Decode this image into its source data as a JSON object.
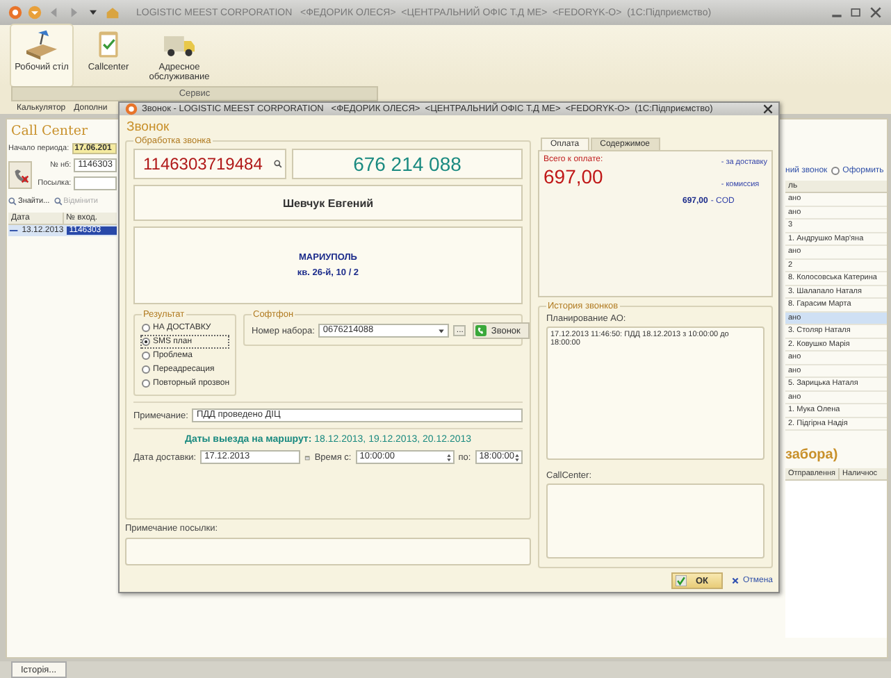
{
  "window": {
    "title": "LOGISTIC MEEST CORPORATION   <ФЕДОРИК ОЛЕСЯ>  <ЦЕНТРАЛЬНИЙ ОФІС Т.Д МЕ>  <FEDORYK-O>  (1С:Підприємство)"
  },
  "ribbon": [
    {
      "label": "Робочий стіл",
      "kind": "desk",
      "selected": true
    },
    {
      "label": "Callcenter",
      "kind": "clipboard",
      "selected": false
    },
    {
      "label": "Адресное обслуживание",
      "kind": "truck",
      "selected": false
    }
  ],
  "service_bar": {
    "title": "Сервис",
    "items": [
      "Калькулятор",
      "Дополни"
    ]
  },
  "call_center": {
    "title": "Call Center",
    "period_label": "Начало периода:",
    "period_value": "17.06.201",
    "nb_label": "№ нб:",
    "nb_value": "1146303",
    "parcel_label": "Посылка:",
    "actions": [
      {
        "label": "Знайти...",
        "disabled": false
      },
      {
        "label": "Відмінити",
        "disabled": true
      }
    ],
    "columns": [
      "Дата",
      "№ вход."
    ],
    "rows": [
      {
        "date": "13.12.2013",
        "number": "1146303",
        "selected": true
      }
    ]
  },
  "right_panel": {
    "option_label": "ний звонок",
    "option": {
      "label": "Оформить",
      "selected": false
    },
    "column": "ль",
    "rows": [
      {
        "text": "ано",
        "selected": false
      },
      {
        "text": "ано",
        "selected": false
      },
      {
        "text": "3",
        "selected": false
      },
      {
        "text": "1. Андрушко Мар'яна",
        "selected": false
      },
      {
        "text": "ано",
        "selected": false
      },
      {
        "text": "2",
        "selected": false
      },
      {
        "text": "8. Колосовська Катерина",
        "selected": false
      },
      {
        "text": "3. Шалапало Наталя",
        "selected": false
      },
      {
        "text": "8. Гарасим Марта",
        "selected": false
      },
      {
        "text": "ано",
        "selected": true
      },
      {
        "text": "3. Столяр Наталя",
        "selected": false
      },
      {
        "text": "2. Ковушко Марія",
        "selected": false
      },
      {
        "text": "ано",
        "selected": false
      },
      {
        "text": "ано",
        "selected": false
      },
      {
        "text": "5. Зарицька Наталя",
        "selected": false
      },
      {
        "text": "ано",
        "selected": false
      },
      {
        "text": "1. Мука Олена",
        "selected": false
      },
      {
        "text": "2. Підгірна Надія",
        "selected": false
      }
    ],
    "section_title": "забора)",
    "columns": [
      "Отправлення",
      "Наличнос"
    ]
  },
  "dialog": {
    "title": "Звонок - LOGISTIC MEEST CORPORATION   <ФЕДОРИК ОЛЕСЯ>  <ЦЕНТРАЛЬНИЙ ОФІС Т.Д МЕ>  <FEDORYK-O>  (1С:Підприємство)",
    "heading": "Звонок",
    "processing": {
      "title": "Обработка звонка",
      "barcode": "1146303719484",
      "phone": "676 214 088",
      "name": "Шевчук Евгений",
      "city": "МАРИУПОЛЬ",
      "address": "кв. 26-й, 10 / 2"
    },
    "result": {
      "title": "Результат",
      "options": [
        {
          "label": "НА ДОСТАВКУ",
          "selected": false
        },
        {
          "label": "SMS план",
          "selected": true
        },
        {
          "label": "Проблема",
          "selected": false
        },
        {
          "label": "Переадресация",
          "selected": false
        },
        {
          "label": "Повторный прозвон",
          "selected": false
        }
      ]
    },
    "softphone": {
      "title": "Софтфон",
      "number_label": "Номер набора:",
      "number": "0676214088",
      "call_button": "Звонок",
      "more_button": "..."
    },
    "note_label": "Примечание:",
    "note": "ПДД проведено ДІЦ",
    "route_dates": "**Даты выезда на маршрут:** 18.12.2013, 19.12.2013, 20.12.2013",
    "delivery_label": "Дата доставки:",
    "delivery_date": "17.12.2013",
    "time_from_label": "Время с:",
    "time_from": "10:00:00",
    "time_to_label": "по:",
    "time_to": "18:00:00",
    "parcel_note_label": "Примечание посылки:",
    "payment": {
      "tabs": [
        {
          "label": "Оплата",
          "selected": true
        },
        {
          "label": "Содержимое",
          "selected": false
        }
      ],
      "total_label": "Всего к оплате:",
      "total": "697,00",
      "delivery_fee": "- за доставку",
      "commission": "- комиссия",
      "cod_amount": "697,00",
      "cod_label": "- COD"
    },
    "history": {
      "title": "История звонков",
      "planning_label": "Планирование АО:",
      "planning_text": "17.12.2013 11:46:50: ПДД 18.12.2013 з 10:00:00 до 18:00:00",
      "callcenter_label": "CallCenter:"
    },
    "buttons": {
      "ok": "ОК",
      "cancel": "Отмена"
    }
  },
  "taskbar": [
    {
      "label": "Історія...",
      "selected": true
    }
  ]
}
